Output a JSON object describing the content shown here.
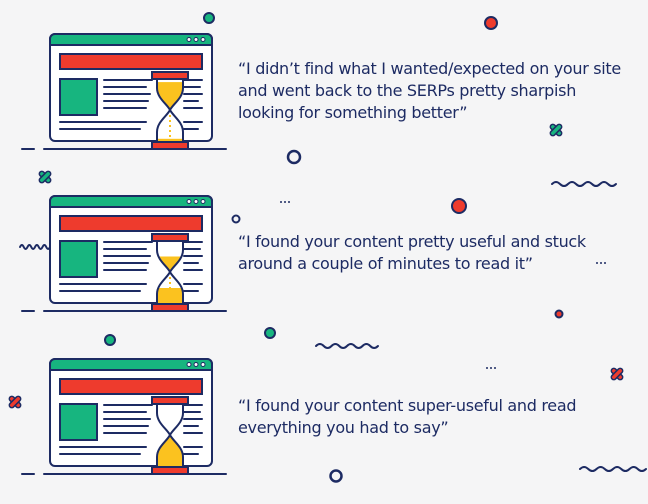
{
  "colors": {
    "navy": "#1d2b63",
    "teal": "#17b57f",
    "red": "#ee3b2d",
    "yellow": "#fbc21f",
    "white": "#ffffff",
    "background": "#f5f5f6"
  },
  "icons": [
    "browser-window-icon",
    "hourglass-icon",
    "circle-decoration",
    "cross-decoration",
    "squiggle-decoration",
    "ellipsis-decoration"
  ],
  "scenarios": [
    {
      "sand_level": 0.1,
      "quote_lines": [
        "“I didn’t find what I wanted/expected on your site",
        "and went back to the SERPs pretty sharpish",
        "looking for something better”"
      ]
    },
    {
      "sand_level": 0.5,
      "quote_lines": [
        "“I found your content pretty useful and stuck",
        "around a couple of minutes to read it”"
      ]
    },
    {
      "sand_level": 0.95,
      "quote_lines": [
        "“I found your content super-useful and read",
        "everything you had to say”"
      ]
    }
  ]
}
